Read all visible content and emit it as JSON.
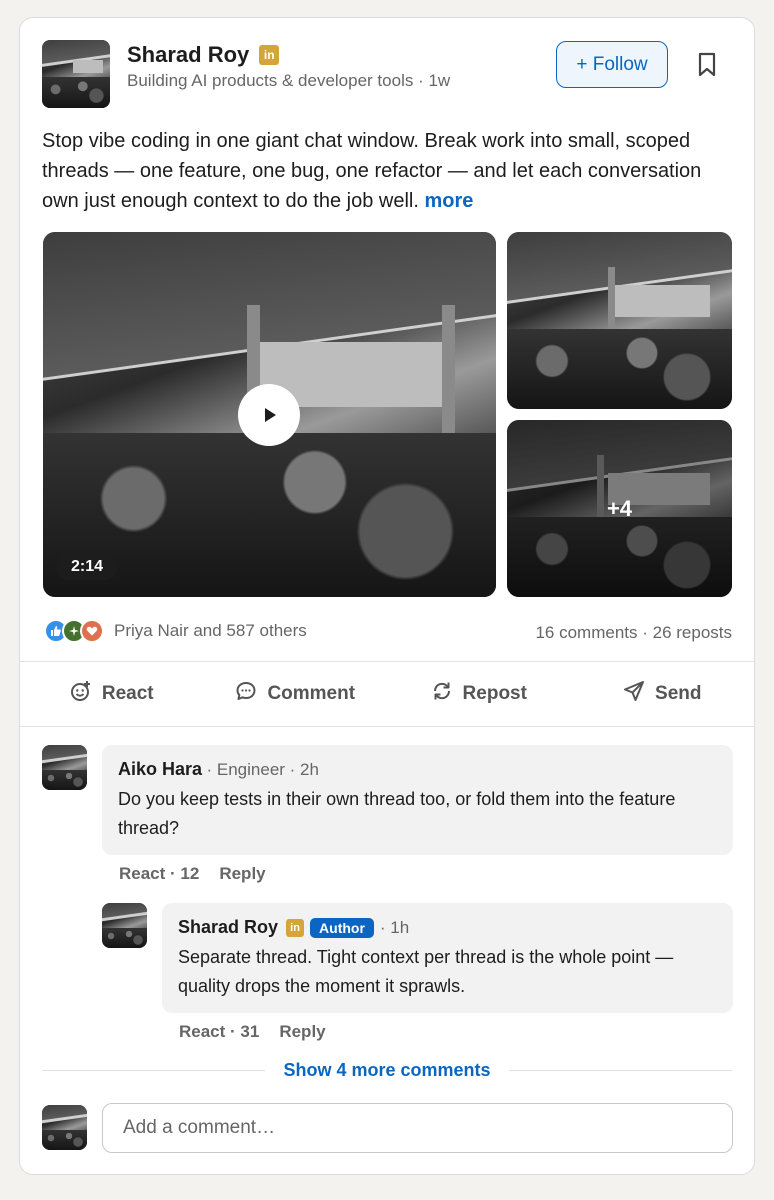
{
  "post": {
    "author_name": "Sharad Roy",
    "badge": "in",
    "subtitle": "Building AI products & developer tools · 1w",
    "follow_label": "+ Follow",
    "text": "Stop vibe coding in one giant chat window. Break work into small, scoped threads — one feature, one bug, one refactor — and let each conversation own just enough context to do the job well.",
    "more_label": "more",
    "video_duration": "2:14",
    "extra_media_count": "+4",
    "reactions_text": "Priya Nair and 587 others",
    "counts_text": "16 comments · 26 reposts"
  },
  "actions": {
    "react": "React",
    "comment": "Comment",
    "repost": "Repost",
    "send": "Send"
  },
  "comments": [
    {
      "name": "Aiko Hara",
      "meta": "· Engineer · 2h",
      "text": "Do you keep tests in their own thread too, or fold them into the feature thread?",
      "react_label": "React · 12",
      "reply_label": "Reply"
    },
    {
      "name": "Sharad Roy",
      "badge": "in",
      "author_label": "Author",
      "meta": "· 1h",
      "text": "Separate thread. Tight context per thread is the whole point — quality drops the moment it sprawls.",
      "react_label": "React · 31",
      "reply_label": "Reply"
    }
  ],
  "show_more_label": "Show 4 more comments",
  "add_comment_placeholder": "Add a comment…",
  "colors": {
    "accent": "#0a66c2",
    "linkedin_badge": "#d4a63a",
    "like": "#378fe9",
    "celebrate": "#44712e",
    "love": "#df704d"
  },
  "icons": [
    "bookmark-icon",
    "play-icon",
    "like-reaction-icon",
    "celebrate-reaction-icon",
    "love-reaction-icon",
    "react-icon",
    "comment-icon",
    "repost-icon",
    "send-icon"
  ]
}
